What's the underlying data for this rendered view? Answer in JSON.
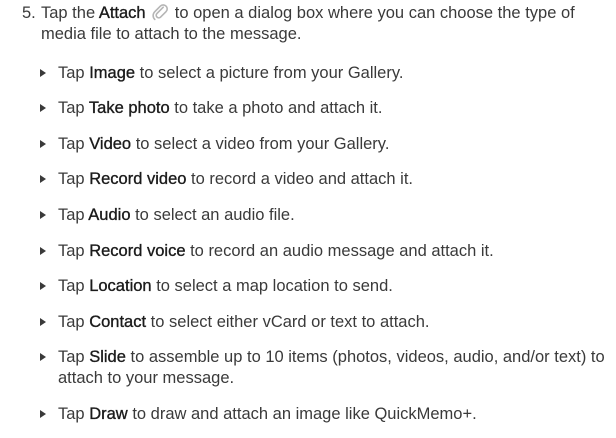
{
  "step": {
    "number": "5.",
    "lead": "Tap the",
    "bold": "Attach",
    "icon": "paperclip-icon",
    "rest": "to open a dialog box where you can choose the type of media file to attach to the message."
  },
  "bullets": [
    {
      "prefix": "Tap",
      "bold": "Image",
      "rest": "to select a picture from your Gallery."
    },
    {
      "prefix": "Tap",
      "bold": "Take photo",
      "rest": "to take a photo and attach it."
    },
    {
      "prefix": "Tap",
      "bold": "Video",
      "rest": "to select a video from your Gallery."
    },
    {
      "prefix": "Tap",
      "bold": "Record video",
      "rest": "to record a video and attach it."
    },
    {
      "prefix": "Tap",
      "bold": "Audio",
      "rest": "to select an audio file."
    },
    {
      "prefix": "Tap",
      "bold": "Record voice",
      "rest": "to record an audio message and attach it."
    },
    {
      "prefix": "Tap",
      "bold": "Location",
      "rest": "to select a map location to send."
    },
    {
      "prefix": "Tap",
      "bold": "Contact",
      "rest": "to select either vCard or text to attach."
    },
    {
      "prefix": "Tap",
      "bold": "Slide",
      "rest": "to assemble up to 10 items (photos, videos, audio, and/or text) to attach to your message."
    },
    {
      "prefix": "Tap",
      "bold": "Draw",
      "rest": "to draw and attach an image like QuickMemo+."
    }
  ],
  "colors": {
    "text": "#3a3a3a",
    "emphasis": "#1b1b1b",
    "icon": "#b5b5b5"
  }
}
